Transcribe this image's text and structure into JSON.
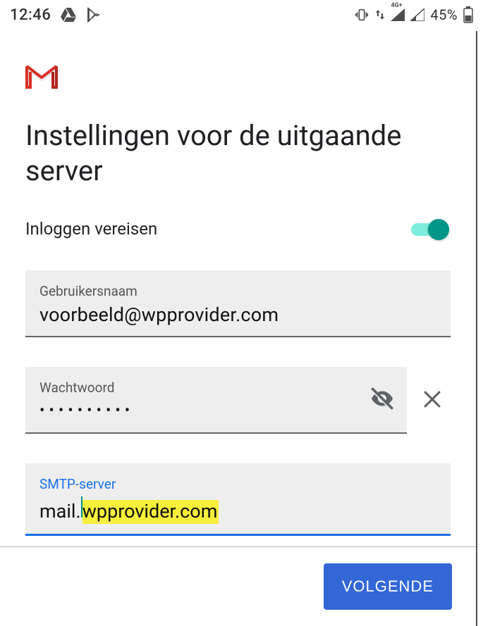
{
  "statusbar": {
    "clock": "12:46",
    "network_label": "4G+",
    "battery_text": "45%"
  },
  "header": {
    "title": "Instellingen voor de uitgaande server"
  },
  "toggle": {
    "label": "Inloggen vereisen",
    "on": true
  },
  "fields": {
    "username": {
      "label": "Gebruikersnaam",
      "value": "voorbeeld@wpprovider.com"
    },
    "password": {
      "label": "Wachtwoord",
      "value_masked": "••••••••••"
    },
    "smtp": {
      "label": "SMTP-server",
      "value_prefix": "mail.",
      "value_highlight": "wpprovider.com"
    }
  },
  "footer": {
    "next_label": "VOLGENDE"
  }
}
